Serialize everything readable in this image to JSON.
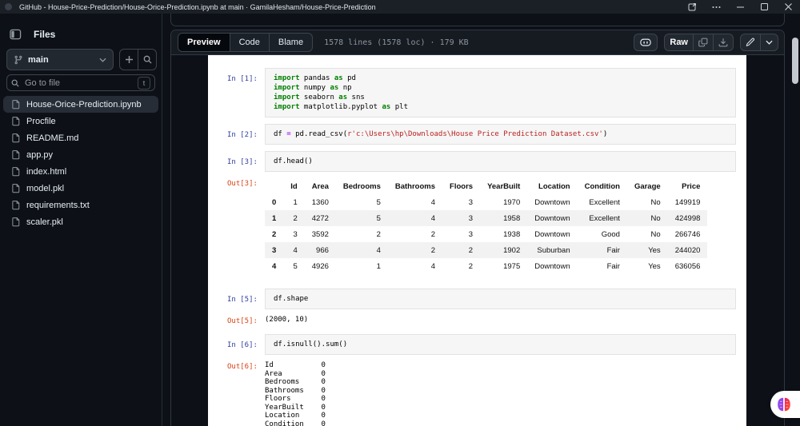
{
  "window": {
    "title": "GitHub - House-Price-Prediction/House-Orice-Prediction.ipynb at main · GamilaHesham/House-Price-Prediction"
  },
  "sidebar": {
    "panel_label": "Files",
    "branch": "main",
    "goto_placeholder": "Go to file",
    "goto_shortcut": "t",
    "files": [
      {
        "name": "House-Orice-Prediction.ipynb",
        "selected": true
      },
      {
        "name": "Procfile",
        "selected": false
      },
      {
        "name": "README.md",
        "selected": false
      },
      {
        "name": "app.py",
        "selected": false
      },
      {
        "name": "index.html",
        "selected": false
      },
      {
        "name": "model.pkl",
        "selected": false
      },
      {
        "name": "requirements.txt",
        "selected": false
      },
      {
        "name": "scaler.pkl",
        "selected": false
      }
    ]
  },
  "toolbar": {
    "tabs": [
      {
        "label": "Preview",
        "active": true
      },
      {
        "label": "Code",
        "active": false
      },
      {
        "label": "Blame",
        "active": false
      }
    ],
    "stats": "1578 lines (1578 loc) · 179 KB",
    "raw_label": "Raw"
  },
  "notebook": {
    "cells": [
      {
        "prompt": "In [1]:",
        "kind": "code",
        "lines": [
          [
            [
              "k",
              "import"
            ],
            [
              "n",
              " pandas "
            ],
            [
              "k",
              "as"
            ],
            [
              "n",
              " pd"
            ]
          ],
          [
            [
              "k",
              "import"
            ],
            [
              "n",
              " numpy "
            ],
            [
              "k",
              "as"
            ],
            [
              "n",
              " np"
            ]
          ],
          [
            [
              "k",
              "import"
            ],
            [
              "n",
              " seaborn "
            ],
            [
              "k",
              "as"
            ],
            [
              "n",
              " sns"
            ]
          ],
          [
            [
              "k",
              "import"
            ],
            [
              "n",
              " matplotlib.pyplot "
            ],
            [
              "k",
              "as"
            ],
            [
              "n",
              " plt"
            ]
          ]
        ]
      },
      {
        "prompt": "In [2]:",
        "kind": "code",
        "lines": [
          [
            [
              "n",
              "df "
            ],
            [
              "o",
              "="
            ],
            [
              "n",
              " pd.read_csv("
            ],
            [
              "s",
              "r'c:\\Users\\hp\\Downloads\\House Price Prediction Dataset.csv'"
            ],
            [
              "n",
              ")"
            ]
          ]
        ]
      },
      {
        "prompt": "In [3]:",
        "kind": "code",
        "lines": [
          [
            [
              "n",
              "df.head()"
            ]
          ]
        ]
      },
      {
        "prompt": "Out[3]:",
        "kind": "table",
        "headers": [
          "",
          "Id",
          "Area",
          "Bedrooms",
          "Bathrooms",
          "Floors",
          "YearBuilt",
          "Location",
          "Condition",
          "Garage",
          "Price"
        ],
        "rows": [
          [
            "0",
            "1",
            "1360",
            "5",
            "4",
            "3",
            "1970",
            "Downtown",
            "Excellent",
            "No",
            "149919"
          ],
          [
            "1",
            "2",
            "4272",
            "5",
            "4",
            "3",
            "1958",
            "Downtown",
            "Excellent",
            "No",
            "424998"
          ],
          [
            "2",
            "3",
            "3592",
            "2",
            "2",
            "3",
            "1938",
            "Downtown",
            "Good",
            "No",
            "266746"
          ],
          [
            "3",
            "4",
            "966",
            "4",
            "2",
            "2",
            "1902",
            "Suburban",
            "Fair",
            "Yes",
            "244020"
          ],
          [
            "4",
            "5",
            "4926",
            "1",
            "4",
            "2",
            "1975",
            "Downtown",
            "Fair",
            "Yes",
            "636056"
          ]
        ]
      },
      {
        "prompt": "In [5]:",
        "kind": "code",
        "lines": [
          [
            [
              "n",
              "df.shape"
            ]
          ]
        ]
      },
      {
        "prompt": "Out[5]:",
        "kind": "out",
        "lines": [
          "(2000, 10)"
        ]
      },
      {
        "prompt": "In [6]:",
        "kind": "code",
        "lines": [
          [
            [
              "n",
              "df.isnull().sum()"
            ]
          ]
        ]
      },
      {
        "prompt": "Out[6]:",
        "kind": "out",
        "lines": [
          "Id           0",
          "Area         0",
          "Bedrooms     0",
          "Bathrooms    0",
          "Floors       0",
          "YearBuilt    0",
          "Location     0",
          "Condition    0"
        ]
      }
    ]
  },
  "colors": {
    "in_prompt": "#303f9f",
    "out_prompt": "#d84315",
    "keyword": "#008000",
    "string": "#ba2121",
    "operator": "#aa22ff",
    "selected_row_bg": "#272d36",
    "notebook_bg": "#ffffff",
    "page_bg": "#0d1117"
  }
}
